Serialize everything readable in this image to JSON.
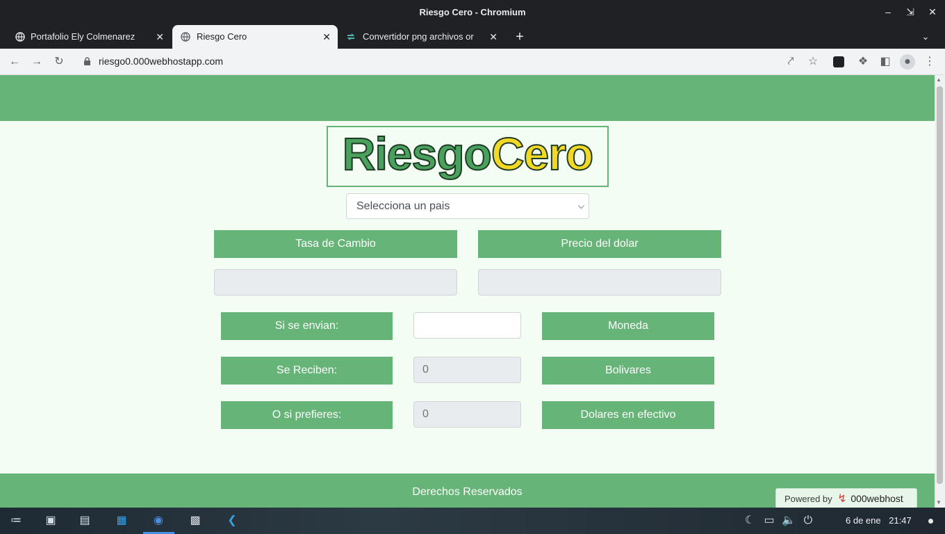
{
  "window": {
    "title": "Riesgo Cero - Chromium"
  },
  "tabs": [
    {
      "label": "Portafolio Ely Colmenarez"
    },
    {
      "label": "Riesgo Cero"
    },
    {
      "label": "Convertidor png archivos or"
    }
  ],
  "address_bar": {
    "url": "riesgo0.000webhostapp.com"
  },
  "page": {
    "logo": {
      "part1": "Riesgo",
      "part2": "Cero"
    },
    "country_select": {
      "selected": "Selecciona un pais"
    },
    "exchange_rate_label": "Tasa de Cambio",
    "dollar_price_label": "Precio del dolar",
    "exchange_rate_value": "",
    "dollar_price_value": "",
    "rows": [
      {
        "label": "Si se envian:",
        "value": "",
        "unit": "Moneda"
      },
      {
        "label": "Se Reciben:",
        "value": "0",
        "unit": "Bolivares"
      },
      {
        "label": "O si prefieres:",
        "value": "0",
        "unit": "Dolares en efectivo"
      }
    ],
    "footer": "Derechos Reservados",
    "powered_by": {
      "label": "Powered by",
      "brand": "000webhost"
    }
  },
  "taskbar": {
    "date": "6 de ene",
    "time": "21:47"
  },
  "colors": {
    "brand_green": "#66b477",
    "page_bg": "#f4fdf3",
    "logo_yellow": "#f4d826"
  }
}
